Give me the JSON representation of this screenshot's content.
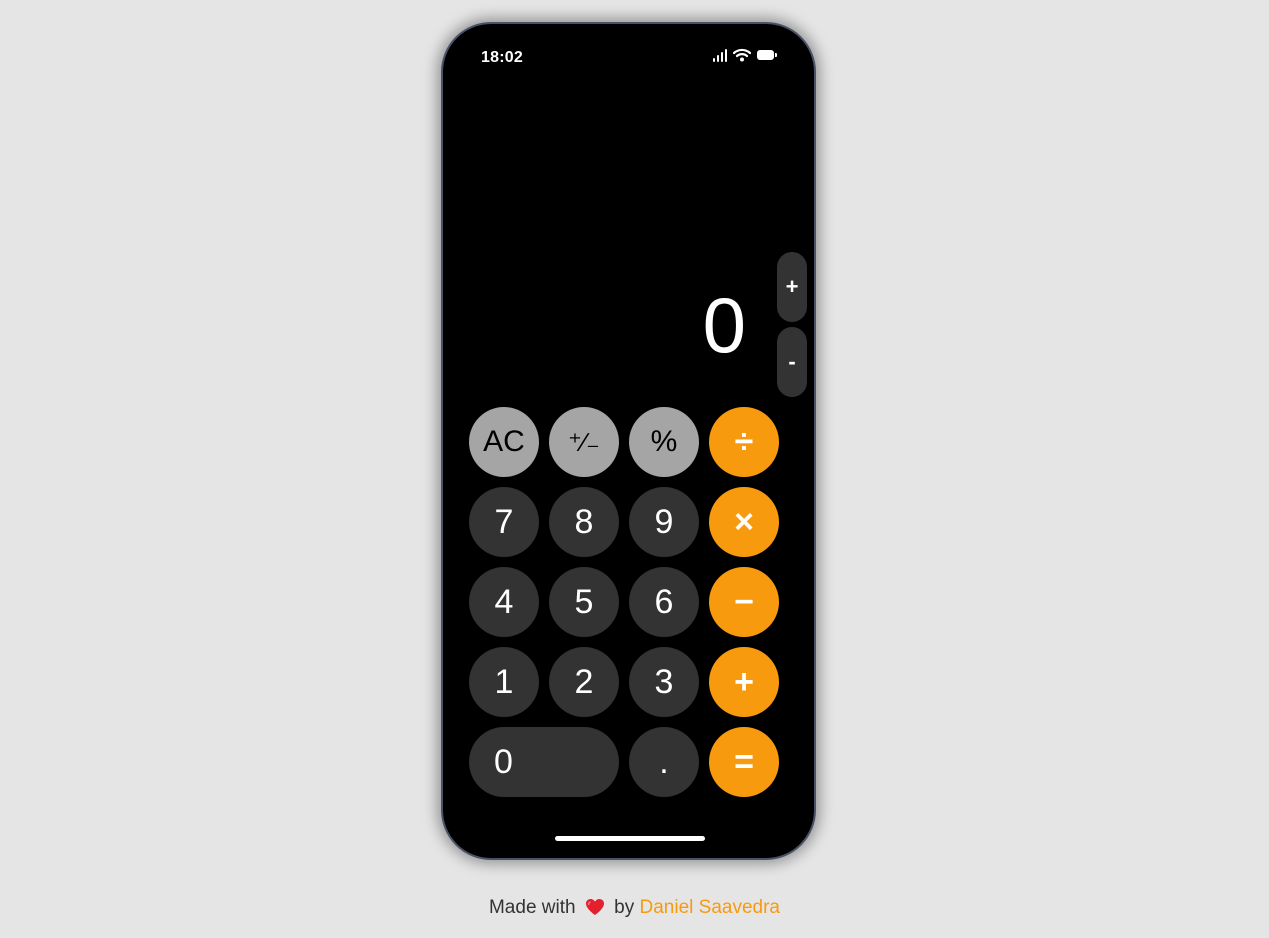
{
  "status": {
    "time": "18:02",
    "icons": [
      "signal-icon",
      "wifi-icon",
      "battery-icon"
    ]
  },
  "display": {
    "value": "0"
  },
  "side_buttons": {
    "plus": "+",
    "minus": "-"
  },
  "keys": {
    "ac": "AC",
    "sign": "⁺∕₋",
    "percent": "%",
    "divide": "÷",
    "seven": "7",
    "eight": "8",
    "nine": "9",
    "multiply": "×",
    "four": "4",
    "five": "5",
    "six": "6",
    "minus": "−",
    "one": "1",
    "two": "2",
    "three": "3",
    "plus": "+",
    "zero": "0",
    "decimal": ".",
    "equals": "="
  },
  "footer": {
    "made_with": "Made with",
    "heart_icon": "heart-icon",
    "by": "by",
    "author": "Daniel Saavedra"
  },
  "colors": {
    "background": "#e5e5e5",
    "phone": "#000000",
    "function_key": "#a5a5a5",
    "number_key": "#333333",
    "operator_key": "#f79a0e",
    "link": "#f79a0e"
  }
}
